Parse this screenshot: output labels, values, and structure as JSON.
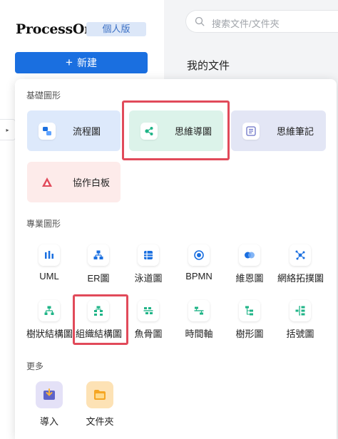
{
  "app": {
    "logo": "ProcessOn",
    "edition_badge": "個人版",
    "new_button": {
      "plus": "+",
      "label": "新建"
    }
  },
  "search": {
    "placeholder": "搜索文件/文件夾"
  },
  "main": {
    "title": "我的文件"
  },
  "collapse_tab": {
    "glyph": "▸"
  },
  "dropdown": {
    "basic_section": {
      "title": "基礎圖形",
      "items": [
        {
          "label": "流程圖",
          "icon": "flowchart-icon",
          "bg": "#dde9fb"
        },
        {
          "label": "思維導圖",
          "icon": "mindmap-icon",
          "bg": "#dcf3ea"
        },
        {
          "label": "思維筆記",
          "icon": "mind-note-icon",
          "bg": "#e3e6f5"
        },
        {
          "label": "協作白板",
          "icon": "whiteboard-icon",
          "bg": "#fdebea"
        }
      ]
    },
    "pro_section": {
      "title": "專業圖形",
      "items": [
        {
          "label": "UML",
          "icon": "uml-icon"
        },
        {
          "label": "ER圖",
          "icon": "er-diagram-icon"
        },
        {
          "label": "泳道圖",
          "icon": "swimlane-icon"
        },
        {
          "label": "BPMN",
          "icon": "bpmn-icon"
        },
        {
          "label": "維恩圖",
          "icon": "venn-icon"
        },
        {
          "label": "網絡拓撲圖",
          "icon": "network-topology-icon"
        },
        {
          "label": "樹狀結構圖",
          "icon": "tree-structure-icon"
        },
        {
          "label": "組織結構圖",
          "icon": "org-chart-icon"
        },
        {
          "label": "魚骨圖",
          "icon": "fishbone-icon"
        },
        {
          "label": "時間軸",
          "icon": "timeline-icon"
        },
        {
          "label": "樹形圖",
          "icon": "tree-diagram-icon"
        },
        {
          "label": "括號圖",
          "icon": "bracket-icon"
        }
      ]
    },
    "more_section": {
      "title": "更多",
      "items": [
        {
          "label": "導入",
          "icon": "import-icon"
        },
        {
          "label": "文件夾",
          "icon": "folder-icon"
        }
      ]
    }
  },
  "colors": {
    "brand_blue": "#1a6fe0",
    "highlight_red": "#e14a5a",
    "teal": "#1fb487"
  }
}
